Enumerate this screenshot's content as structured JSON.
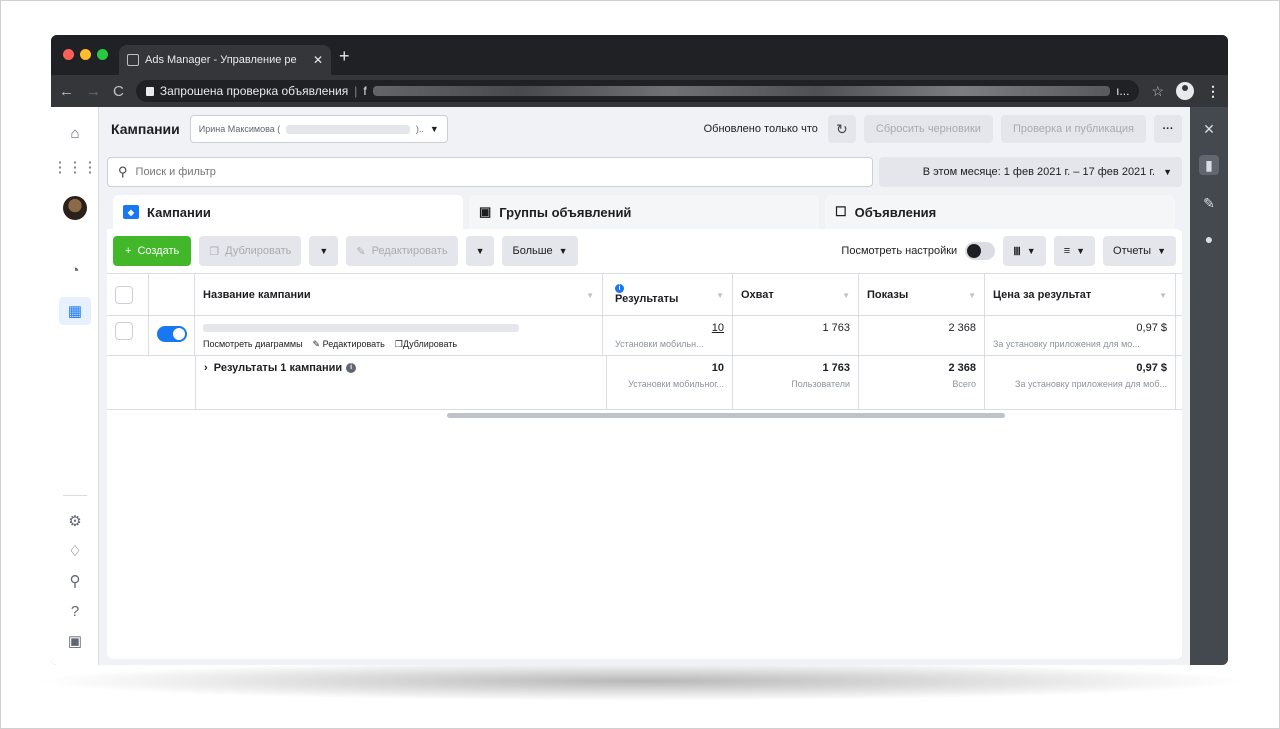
{
  "browser": {
    "tab_title": "Ads Manager - Управление ре",
    "address_text": "Запрошена проверка объявления",
    "address_prefix": "f",
    "address_tail": "ı..."
  },
  "header": {
    "title": "Кампании",
    "account_name": "Ирина Максимова (",
    "account_suffix": ")..",
    "updated": "Обновлено только что",
    "reset_drafts": "Сбросить черновики",
    "review_publish": "Проверка и публикация",
    "more": "···"
  },
  "search": {
    "placeholder": "Поиск и фильтр",
    "date_range": "В этом месяце: 1 фев 2021 г. – 17 фев 2021 г."
  },
  "tabs": [
    {
      "label": "Кампании"
    },
    {
      "label": "Группы объявлений"
    },
    {
      "label": "Объявления"
    }
  ],
  "toolbar": {
    "create": "Создать",
    "duplicate": "Дублировать",
    "edit": "Редактировать",
    "more": "Больше",
    "view_settings": "Посмотреть настройки",
    "reports": "Отчеты"
  },
  "table": {
    "headers": {
      "name": "Название кампании",
      "results": "Результаты",
      "reach": "Охват",
      "impressions": "Показы",
      "cost": "Цена за результат"
    },
    "row": {
      "actions": {
        "charts": "Посмотреть диаграммы",
        "edit": "Редактировать",
        "duplicate": "Дублировать"
      },
      "results": "10",
      "results_sub": "Установки мобильн...",
      "reach": "1 763",
      "impressions": "2 368",
      "cost": "0,97 $",
      "cost_sub": "За установку приложения для мо..."
    },
    "summary": {
      "label": "Результаты 1 кампании",
      "results": "10",
      "results_sub": "Установки мобильног...",
      "reach": "1 763",
      "reach_sub": "Пользователи",
      "impressions": "2 368",
      "impressions_sub": "Всего",
      "cost": "0,97 $",
      "cost_sub": "За установку приложения для моб..."
    }
  },
  "colors": {
    "brand": "#1877f2",
    "create": "#42b72a"
  }
}
